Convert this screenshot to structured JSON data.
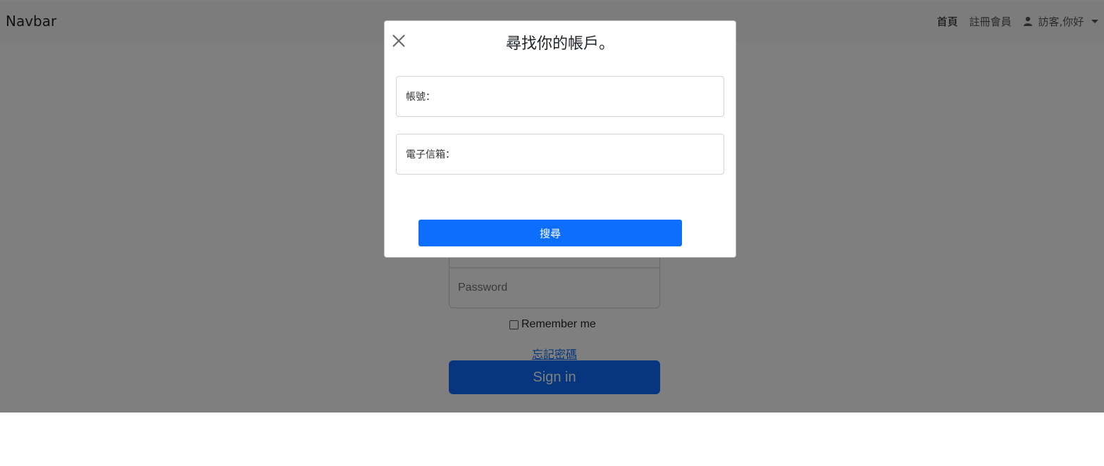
{
  "navbar": {
    "brand": "Navbar",
    "links": [
      "首頁",
      "註冊會員"
    ],
    "user_menu_label": "訪客,你好"
  },
  "login": {
    "password_placeholder": "Password",
    "remember_label": "Remember me",
    "forgot_link": "忘記密碼",
    "signin_label": "Sign in"
  },
  "modal": {
    "title": "尋找你的帳戶。",
    "account_label": "帳號：",
    "email_label": "電子信箱：",
    "search_button": "搜尋"
  },
  "colors": {
    "primary": "#0d6efd",
    "backdrop": "rgba(0,0,0,0.5)"
  }
}
